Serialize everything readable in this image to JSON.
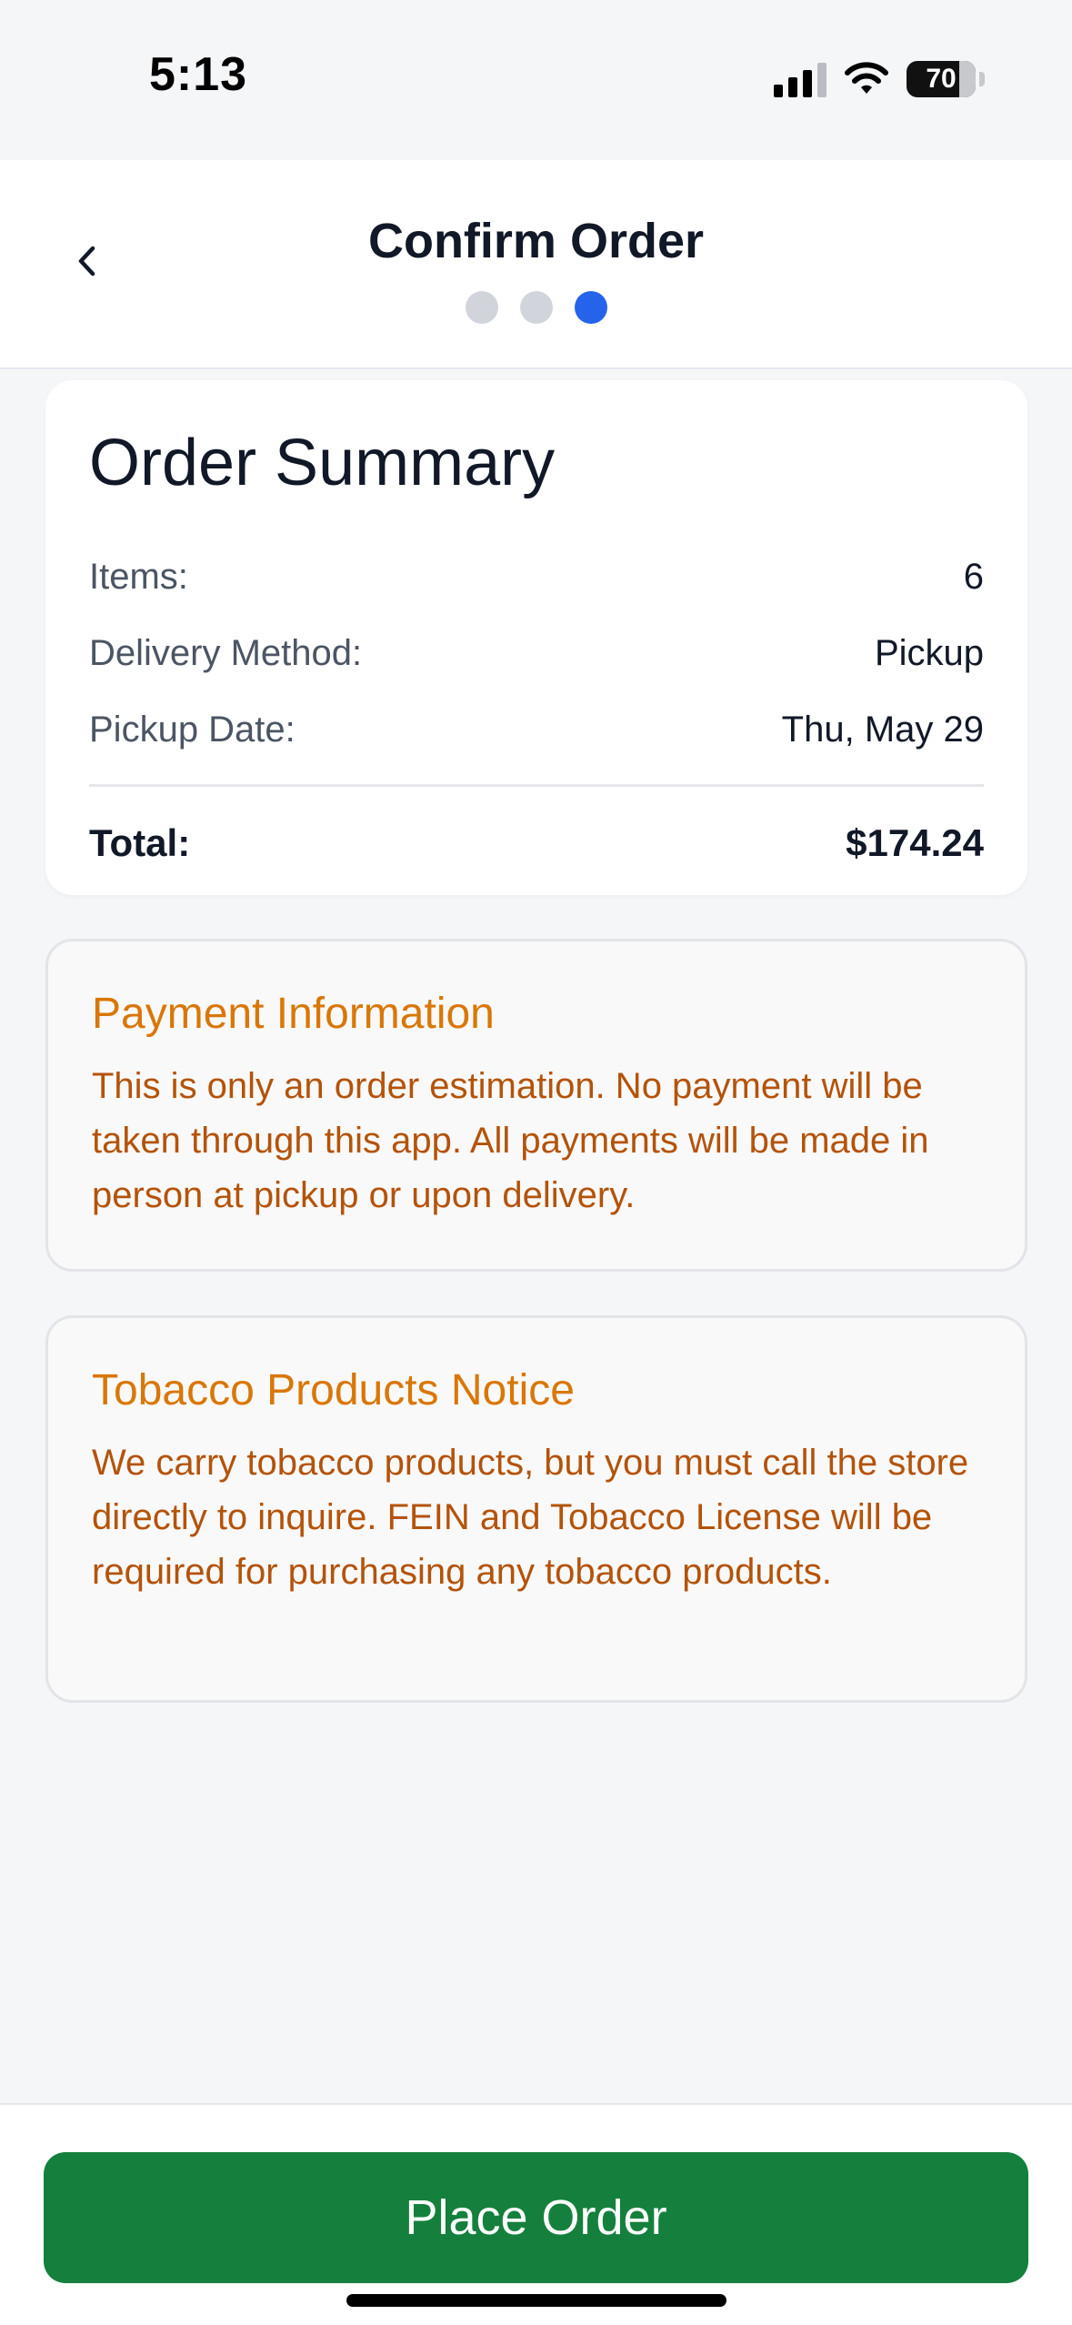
{
  "status_bar": {
    "time": "5:13",
    "battery": "70"
  },
  "header": {
    "title": "Confirm Order",
    "back_icon": "chevron-left-icon",
    "steps_total": 3,
    "active_step": 3
  },
  "summary": {
    "title": "Order Summary",
    "rows": [
      {
        "label": "Items:",
        "value": "6"
      },
      {
        "label": "Delivery Method:",
        "value": "Pickup"
      },
      {
        "label": "Pickup Date:",
        "value": "Thu, May 29"
      }
    ],
    "total_label": "Total:",
    "total_value": "$174.24"
  },
  "payment_notice": {
    "title": "Payment Information",
    "body": "This is only an order estimation. No payment will be taken through this app. All payments will be made in person at pickup or upon delivery."
  },
  "tobacco_notice": {
    "title": "Tobacco Products Notice",
    "body": "We carry tobacco products, but you must call the store directly to inquire. FEIN and Tobacco License will be required for purchasing any tobacco products."
  },
  "footer": {
    "place_order_label": "Place Order"
  },
  "colors": {
    "accent_blue": "#2563eb",
    "button_green": "#15803d",
    "notice_orange": "#d97706"
  }
}
